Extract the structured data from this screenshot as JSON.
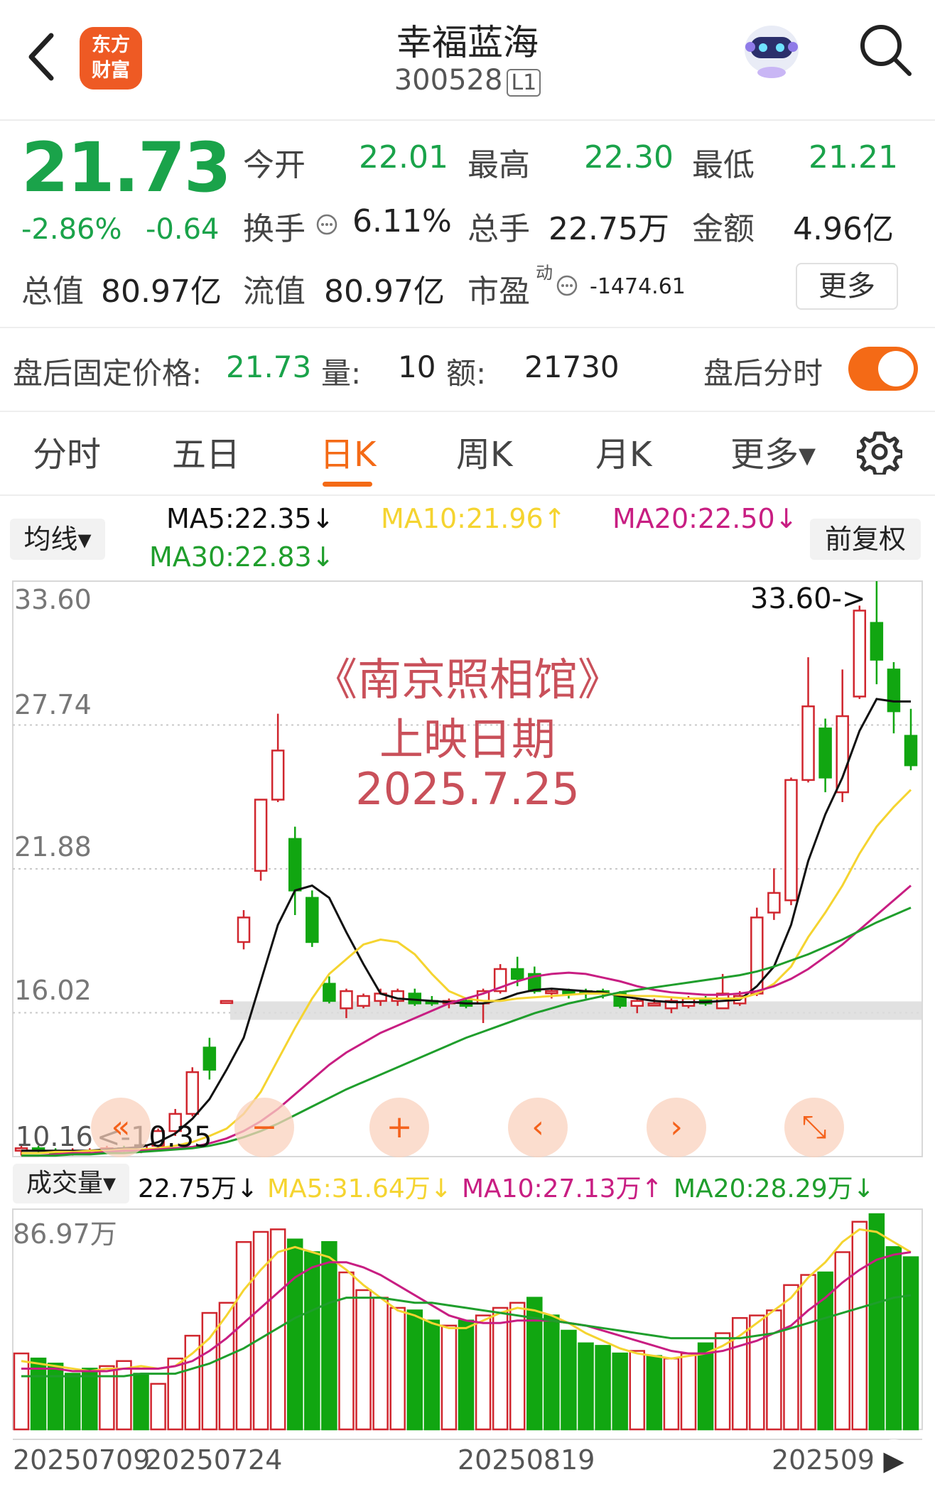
{
  "header": {
    "logo_line1": "东方",
    "logo_line2": "财富",
    "title": "幸福蓝海",
    "code": "300528",
    "code_tag": "L1",
    "back_icon": "chevron-left-icon",
    "assistant_icon": "robot-icon",
    "search_icon": "search-icon"
  },
  "quote": {
    "price": "21.73",
    "change_pct": "-2.86%",
    "change": "-0.64",
    "open_label": "今开",
    "open": "22.01",
    "high_label": "最高",
    "high": "22.30",
    "low_label": "最低",
    "low": "21.21",
    "turnover_label": "换手",
    "turnover": "6.11%",
    "volume_label": "总手",
    "volume": "22.75万",
    "amount_label": "金额",
    "amount": "4.96亿",
    "mktcap_label": "总值",
    "mktcap": "80.97亿",
    "float_label": "流值",
    "float": "80.97亿",
    "pe_label": "市盈",
    "pe_sup": "动",
    "pe": "-1474.61",
    "more_label": "更多"
  },
  "after_hours": {
    "price_label": "盘后固定价格:",
    "price": "21.73",
    "vol_label": "量:",
    "vol": "10",
    "amt_label": "额:",
    "amt": "21730",
    "toggle_label": "盘后分时",
    "toggle_on": true
  },
  "tabs": [
    {
      "label": "分时"
    },
    {
      "label": "五日"
    },
    {
      "label": "日K"
    },
    {
      "label": "周K"
    },
    {
      "label": "月K"
    },
    {
      "label": "更多▾"
    }
  ],
  "active_tab": "日K",
  "ma_legend": {
    "selector": "均线▾",
    "ma5": "MA5:22.35↓",
    "ma10": "MA10:21.96↑",
    "ma20": "MA20:22.50↓",
    "ma30": "MA30:22.83↓",
    "adjust": "前复权"
  },
  "colors": {
    "up": "#d0262e",
    "down": "#11a611",
    "ma5": "#111111",
    "ma10": "#f5d430",
    "ma20": "#c81e82",
    "ma30": "#1f9e2c",
    "accent": "#f46a16",
    "annotation": "#c9505a"
  },
  "annotation": {
    "line1": "《南京照相馆》",
    "line2": "上映日期",
    "line3": "2025.7.25"
  },
  "nav_buttons": [
    "«",
    "−",
    "+",
    "‹",
    "›",
    "⤡"
  ],
  "volume_legend": {
    "selector": "成交量▾",
    "vol": "22.75万↓",
    "ma5": "MA5:31.64万↓",
    "ma10": "MA10:27.13万↑",
    "ma20": "MA20:28.29万↓",
    "max_label": "86.97万"
  },
  "chart_data": [
    {
      "type": "candlestick",
      "title": "",
      "y_ticks": [
        "33.60",
        "27.74",
        "21.88",
        "16.02"
      ],
      "ylim": [
        10.16,
        33.6
      ],
      "max_label": "33.60->",
      "min_label": "10.16",
      "min_arrow_label": "<-10.35",
      "x_ticks": [
        "20250709",
        "20250724",
        "20250819",
        "202509"
      ],
      "candles": [
        [
          10.4,
          10.5,
          10.2,
          10.6
        ],
        [
          10.5,
          10.4,
          10.3,
          10.6
        ],
        [
          10.4,
          10.3,
          10.2,
          10.5
        ],
        [
          10.3,
          10.4,
          10.2,
          10.5
        ],
        [
          10.4,
          10.4,
          10.3,
          10.5
        ],
        [
          10.4,
          10.5,
          10.3,
          10.6
        ],
        [
          10.5,
          10.4,
          10.35,
          10.6
        ],
        [
          10.4,
          10.6,
          10.3,
          10.7
        ],
        [
          10.6,
          11.2,
          10.5,
          11.3
        ],
        [
          11.2,
          11.9,
          11.0,
          12.1
        ],
        [
          11.9,
          13.6,
          11.8,
          13.8
        ],
        [
          14.6,
          13.7,
          13.3,
          15.0
        ],
        [
          16.5,
          16.5,
          16.5,
          16.5
        ],
        [
          18.9,
          19.9,
          18.6,
          20.2
        ],
        [
          21.8,
          24.7,
          21.4,
          24.7
        ],
        [
          24.7,
          26.7,
          24.6,
          28.2
        ],
        [
          23.1,
          21.0,
          20.0,
          23.6
        ],
        [
          20.7,
          18.9,
          18.7,
          21.0
        ],
        [
          17.2,
          16.5,
          16.4,
          17.5
        ],
        [
          16.2,
          16.9,
          15.8,
          17.0
        ],
        [
          16.3,
          16.7,
          16.2,
          16.8
        ],
        [
          16.5,
          16.8,
          16.3,
          17.0
        ],
        [
          16.5,
          16.9,
          16.3,
          17.0
        ],
        [
          16.8,
          16.4,
          16.3,
          17.0
        ],
        [
          16.5,
          16.4,
          16.3,
          16.7
        ],
        [
          16.4,
          16.5,
          16.2,
          16.6
        ],
        [
          16.5,
          16.3,
          16.2,
          16.6
        ],
        [
          16.4,
          16.9,
          15.6,
          17.0
        ],
        [
          16.9,
          17.8,
          16.8,
          18.0
        ],
        [
          17.8,
          17.4,
          17.1,
          18.3
        ],
        [
          17.6,
          16.9,
          16.8,
          17.9
        ],
        [
          16.9,
          16.9,
          16.6,
          17.0
        ],
        [
          16.9,
          16.8,
          16.6,
          17.0
        ],
        [
          16.9,
          16.8,
          16.6,
          17.0
        ],
        [
          16.9,
          16.8,
          16.6,
          17.0
        ],
        [
          16.8,
          16.3,
          16.2,
          16.9
        ],
        [
          16.3,
          16.5,
          16.0,
          16.6
        ],
        [
          16.4,
          16.4,
          16.3,
          16.6
        ],
        [
          16.2,
          16.5,
          16.0,
          16.6
        ],
        [
          16.3,
          16.6,
          16.2,
          16.7
        ],
        [
          16.6,
          16.4,
          16.3,
          16.7
        ],
        [
          16.2,
          16.8,
          16.2,
          17.6
        ],
        [
          16.4,
          16.7,
          16.3,
          16.9
        ],
        [
          16.8,
          19.9,
          16.7,
          20.3
        ],
        [
          20.1,
          20.9,
          19.8,
          21.9
        ],
        [
          20.6,
          25.5,
          20.4,
          25.6
        ],
        [
          25.5,
          28.5,
          25.4,
          30.5
        ],
        [
          27.6,
          25.6,
          25.0,
          28.0
        ],
        [
          25.0,
          28.1,
          24.6,
          30.0
        ],
        [
          28.9,
          32.4,
          28.8,
          32.6
        ],
        [
          31.9,
          30.4,
          29.4,
          33.6
        ],
        [
          30.0,
          28.3,
          27.4,
          30.3
        ],
        [
          27.3,
          26.1,
          25.9,
          28.4
        ]
      ],
      "series": [
        {
          "name": "MA5",
          "values": [
            10.4,
            10.4,
            10.4,
            10.4,
            10.4,
            10.45,
            10.5,
            10.55,
            10.75,
            11.1,
            11.7,
            12.5,
            13.7,
            15.0,
            17.3,
            19.6,
            21.0,
            21.2,
            20.7,
            19.3,
            18.0,
            16.8,
            16.6,
            16.55,
            16.5,
            16.45,
            16.4,
            16.4,
            16.55,
            16.8,
            16.95,
            17.0,
            16.95,
            16.9,
            16.85,
            16.7,
            16.6,
            16.5,
            16.45,
            16.45,
            16.45,
            16.5,
            16.55,
            17.1,
            17.9,
            19.6,
            22.2,
            24.1,
            25.6,
            27.5,
            28.8,
            28.7,
            28.7
          ]
        },
        {
          "name": "MA10",
          "values": [
            10.3,
            10.3,
            10.35,
            10.35,
            10.4,
            10.4,
            10.45,
            10.45,
            10.5,
            10.6,
            10.75,
            11.0,
            11.3,
            11.9,
            12.8,
            14.1,
            15.4,
            16.6,
            17.6,
            18.2,
            18.8,
            19.0,
            18.9,
            18.4,
            17.6,
            16.9,
            16.6,
            16.5,
            16.5,
            16.6,
            16.65,
            16.7,
            16.75,
            16.8,
            16.8,
            16.75,
            16.7,
            16.7,
            16.65,
            16.6,
            16.6,
            16.6,
            16.6,
            16.8,
            17.2,
            17.9,
            19.1,
            20.1,
            21.2,
            22.5,
            23.6,
            24.4,
            25.1
          ]
        },
        {
          "name": "MA20",
          "values": [
            10.2,
            10.2,
            10.25,
            10.3,
            10.3,
            10.35,
            10.4,
            10.4,
            10.45,
            10.5,
            10.55,
            10.7,
            10.9,
            11.2,
            11.6,
            12.1,
            12.7,
            13.3,
            13.9,
            14.4,
            14.8,
            15.2,
            15.5,
            15.8,
            16.1,
            16.4,
            16.6,
            16.8,
            17.05,
            17.3,
            17.5,
            17.6,
            17.65,
            17.6,
            17.45,
            17.3,
            17.1,
            16.95,
            16.85,
            16.8,
            16.75,
            16.75,
            16.8,
            16.9,
            17.1,
            17.4,
            17.8,
            18.3,
            18.8,
            19.4,
            20.0,
            20.6,
            21.2
          ]
        },
        {
          "name": "MA30",
          "values": [
            10.2,
            10.2,
            10.2,
            10.25,
            10.25,
            10.3,
            10.3,
            10.35,
            10.4,
            10.45,
            10.5,
            10.6,
            10.75,
            10.95,
            11.2,
            11.5,
            11.85,
            12.2,
            12.55,
            12.9,
            13.2,
            13.5,
            13.8,
            14.1,
            14.4,
            14.7,
            15.0,
            15.25,
            15.5,
            15.75,
            16.0,
            16.2,
            16.4,
            16.55,
            16.7,
            16.85,
            16.95,
            17.05,
            17.15,
            17.25,
            17.35,
            17.45,
            17.55,
            17.7,
            17.9,
            18.15,
            18.4,
            18.7,
            19.0,
            19.35,
            19.7,
            20.0,
            20.3
          ]
        }
      ]
    },
    {
      "type": "bar",
      "title": "",
      "ylim": [
        0,
        86.97
      ],
      "max_label": "86.97万",
      "volumes": [
        30,
        28,
        26,
        22,
        24,
        25,
        27,
        22,
        18,
        28,
        37,
        46,
        50,
        74,
        78,
        79,
        75,
        70,
        74,
        62,
        55,
        52,
        48,
        47,
        43,
        41,
        43,
        45,
        48,
        50,
        52,
        45,
        39,
        34,
        33,
        30,
        31,
        29,
        28,
        30,
        34,
        38,
        44,
        45,
        47,
        57,
        61,
        62,
        70,
        82,
        85,
        72,
        68
      ],
      "up": [
        true,
        false,
        false,
        false,
        false,
        true,
        true,
        false,
        true,
        true,
        true,
        true,
        true,
        true,
        true,
        true,
        false,
        false,
        false,
        true,
        true,
        true,
        true,
        false,
        false,
        true,
        false,
        true,
        true,
        true,
        false,
        false,
        false,
        false,
        false,
        false,
        true,
        false,
        true,
        true,
        false,
        true,
        true,
        true,
        true,
        true,
        true,
        false,
        true,
        true,
        false,
        false,
        false
      ],
      "series": [
        {
          "name": "MA5",
          "values": [
            27,
            26,
            25,
            24,
            23,
            24,
            24,
            25,
            24,
            25,
            30,
            36,
            45,
            55,
            63,
            70,
            72,
            70,
            68,
            63,
            57,
            52,
            47,
            45,
            42,
            40,
            40,
            43,
            46,
            48,
            47,
            45,
            42,
            38,
            35,
            32,
            30,
            29,
            28,
            29,
            30,
            33,
            37,
            42,
            47,
            52,
            60,
            66,
            74,
            79,
            78,
            74,
            70
          ]
        },
        {
          "name": "MA10",
          "values": [
            24,
            24,
            24,
            23,
            23,
            23,
            24,
            24,
            24,
            25,
            27,
            31,
            36,
            42,
            48,
            54,
            60,
            64,
            66,
            66,
            64,
            61,
            57,
            53,
            49,
            45,
            43,
            42,
            42,
            43,
            43,
            43,
            42,
            41,
            39,
            37,
            35,
            33,
            31,
            30,
            30,
            31,
            33,
            35,
            38,
            41,
            47,
            52,
            58,
            63,
            67,
            69,
            70
          ]
        },
        {
          "name": "MA20",
          "values": [
            21,
            21,
            21,
            21,
            21,
            21,
            21,
            22,
            22,
            22,
            24,
            26,
            29,
            32,
            36,
            40,
            44,
            47,
            50,
            52,
            52,
            52,
            51,
            50,
            50,
            49,
            48,
            47,
            46,
            45,
            44,
            43,
            42,
            41,
            40,
            39,
            38,
            37,
            36,
            36,
            36,
            36,
            36,
            37,
            38,
            40,
            42,
            44,
            46,
            48,
            50,
            52,
            53
          ]
        }
      ]
    }
  ]
}
